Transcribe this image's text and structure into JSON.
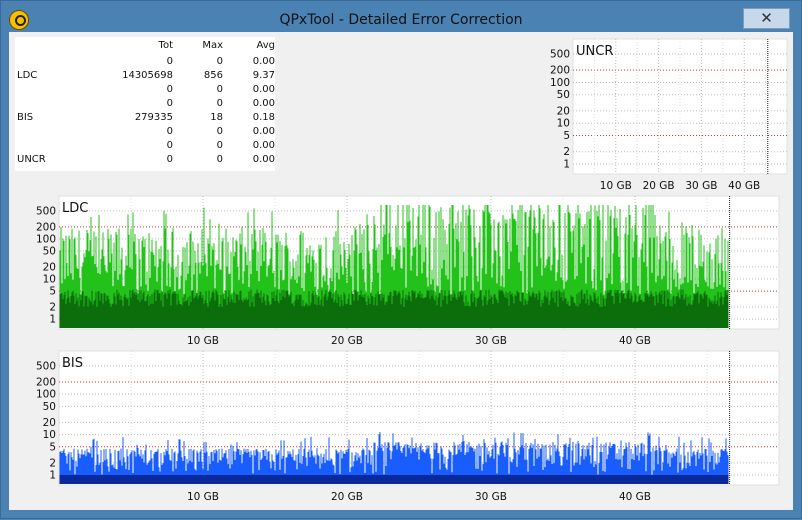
{
  "window": {
    "title": "QPxTool - Detailed Error Correction",
    "close_symbol": "✕"
  },
  "stats": {
    "headers": {
      "tot": "Tot",
      "max": "Max",
      "avg": "Avg"
    },
    "rows": [
      {
        "label": "",
        "tot": "0",
        "max": "0",
        "avg": "0.00"
      },
      {
        "label": "LDC",
        "tot": "14305698",
        "max": "856",
        "avg": "9.37"
      },
      {
        "label": "",
        "tot": "0",
        "max": "0",
        "avg": "0.00"
      },
      {
        "label": "",
        "tot": "0",
        "max": "0",
        "avg": "0.00"
      },
      {
        "label": "BIS",
        "tot": "279335",
        "max": "18",
        "avg": "0.18"
      },
      {
        "label": "",
        "tot": "0",
        "max": "0",
        "avg": "0.00"
      },
      {
        "label": "",
        "tot": "0",
        "max": "0",
        "avg": "0.00"
      },
      {
        "label": "UNCR",
        "tot": "0",
        "max": "0",
        "avg": "0.00"
      }
    ]
  },
  "chart_data": [
    {
      "type": "bar",
      "title": "UNCR",
      "x_ticks": [
        "10 GB",
        "20 GB",
        "30 GB",
        "40 GB"
      ],
      "y_ticks": [
        "500",
        "200",
        "100",
        "50",
        "20",
        "10",
        "5",
        "2",
        "1"
      ],
      "xlim": [
        0,
        50
      ],
      "scale": "log",
      "values": [],
      "color": "#00aa00"
    },
    {
      "type": "bar",
      "title": "LDC",
      "x_ticks": [
        "10 GB",
        "20 GB",
        "30 GB",
        "40 GB"
      ],
      "y_ticks": [
        "500",
        "200",
        "100",
        "50",
        "20",
        "10",
        "5",
        "2",
        "1"
      ],
      "xlim": [
        0,
        50
      ],
      "scale": "log",
      "data_end_gb": 46.5,
      "max": 856,
      "avg": 9.37,
      "colors": {
        "peak": "#22c21a",
        "body": "#0b6e0b"
      }
    },
    {
      "type": "bar",
      "title": "BIS",
      "x_ticks": [
        "10 GB",
        "20 GB",
        "30 GB",
        "40 GB"
      ],
      "y_ticks": [
        "500",
        "200",
        "100",
        "50",
        "20",
        "10",
        "5",
        "2",
        "1"
      ],
      "xlim": [
        0,
        50
      ],
      "scale": "log",
      "data_end_gb": 46.5,
      "max": 18,
      "avg": 0.18,
      "colors": {
        "peak": "#1a5dff",
        "body": "#0a2a9c"
      }
    }
  ]
}
